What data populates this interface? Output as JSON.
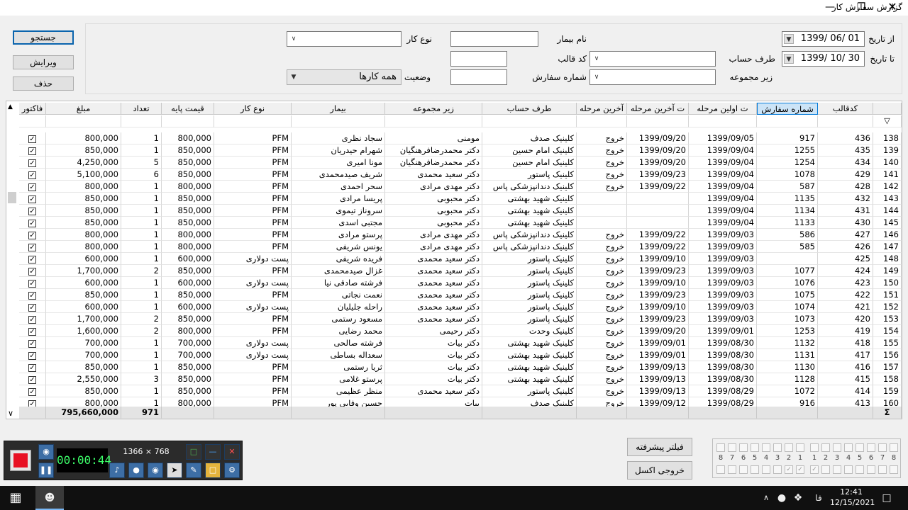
{
  "window": {
    "title": "گزارش سفارش کار"
  },
  "actions": {
    "search": "جستجو",
    "edit": "ویرایش",
    "delete": "حذف"
  },
  "filters": {
    "from_date_label": "از تاریخ",
    "from_date": "1399/ 06/ 01",
    "to_date_label": "تا تاریخ",
    "to_date": "1399/ 10/ 30",
    "account_party_label": "طرف حساب",
    "subgroup_label": "زیر مجموعه",
    "patient_name_label": "نام بیمار",
    "mold_code_label": "کد قالب",
    "order_number_label": "شماره سفارش",
    "work_type_label": "نوع کار",
    "status_label": "وضعیت",
    "status_value": "همه کارها"
  },
  "grid": {
    "columns": {
      "invoice": "فاکتور",
      "amount": "مبلغ",
      "count": "تعداد",
      "base_price": "قیمت پایه",
      "work_type": "نوع کار",
      "patient": "بیمار",
      "subgroup": "زیر مجموعه",
      "account_party": "طرف حساب",
      "last_stage": "آخرین مرحله",
      "last_stage_date": "ت آخرین مرحله",
      "first_stage_date": "ت اولین مرحله",
      "order_no": "شماره سفارش",
      "mold_code": "کدقالب"
    },
    "rows": [
      {
        "rn": "138",
        "mold": "436",
        "order": "917",
        "first": "1399/09/05",
        "lastd": "1399/09/20",
        "last": "خروج",
        "party": "کلینیک صدف",
        "sub": "مومنی",
        "patient": "سجاد نظری",
        "type": "PFM",
        "base": "800,000",
        "count": "1",
        "amount": "800,000"
      },
      {
        "rn": "139",
        "mold": "435",
        "order": "1255",
        "first": "1399/09/04",
        "lastd": "1399/09/20",
        "last": "خروج",
        "party": "کلینیک امام حسین",
        "sub": "دکتر محمدرضافرهنگیان",
        "patient": "شهرام حیدریان",
        "type": "PFM",
        "base": "850,000",
        "count": "1",
        "amount": "850,000"
      },
      {
        "rn": "140",
        "mold": "434",
        "order": "1254",
        "first": "1399/09/04",
        "lastd": "1399/09/20",
        "last": "خروج",
        "party": "کلینیک امام حسین",
        "sub": "دکتر محمدرضافرهنگیان",
        "patient": "مونا امیری",
        "type": "PFM",
        "base": "850,000",
        "count": "5",
        "amount": "4,250,000"
      },
      {
        "rn": "141",
        "mold": "429",
        "order": "1078",
        "first": "1399/09/04",
        "lastd": "1399/09/23",
        "last": "خروج",
        "party": "کلینیک پاستور",
        "sub": "دکتر سعید محمدی",
        "patient": "شریف صیدمحمدی",
        "type": "PFM",
        "base": "850,000",
        "count": "6",
        "amount": "5,100,000"
      },
      {
        "rn": "142",
        "mold": "428",
        "order": "587",
        "first": "1399/09/04",
        "lastd": "1399/09/22",
        "last": "خروج",
        "party": "کلینیک دندانپزشکی پاس",
        "sub": "دکتر مهدی مرادی",
        "patient": "سحر احمدی",
        "type": "PFM",
        "base": "800,000",
        "count": "1",
        "amount": "800,000"
      },
      {
        "rn": "143",
        "mold": "432",
        "order": "1135",
        "first": "1399/09/04",
        "lastd": "",
        "last": "",
        "party": "کلینیک شهید بهشتی",
        "sub": "دکتر محبوبی",
        "patient": "پریسا مرادی",
        "type": "PFM",
        "base": "850,000",
        "count": "1",
        "amount": "850,000"
      },
      {
        "rn": "144",
        "mold": "431",
        "order": "1134",
        "first": "1399/09/04",
        "lastd": "",
        "last": "",
        "party": "کلینیک شهید بهشتی",
        "sub": "دکتر محبوبی",
        "patient": "سروناز تیموی",
        "type": "PFM",
        "base": "850,000",
        "count": "1",
        "amount": "850,000"
      },
      {
        "rn": "145",
        "mold": "430",
        "order": "1133",
        "first": "1399/09/04",
        "lastd": "",
        "last": "",
        "party": "کلینیک شهید بهشتی",
        "sub": "دکتر محبوبی",
        "patient": "مجتبی اسدی",
        "type": "PFM",
        "base": "850,000",
        "count": "1",
        "amount": "850,000"
      },
      {
        "rn": "146",
        "mold": "427",
        "order": "586",
        "first": "1399/09/03",
        "lastd": "1399/09/22",
        "last": "خروج",
        "party": "کلینیک دندانپزشکی پاس",
        "sub": "دکتر مهدی مرادی",
        "patient": "پرستو مرادی",
        "type": "PFM",
        "base": "800,000",
        "count": "1",
        "amount": "800,000"
      },
      {
        "rn": "147",
        "mold": "426",
        "order": "585",
        "first": "1399/09/03",
        "lastd": "1399/09/22",
        "last": "خروج",
        "party": "کلینیک دندانپزشکی پاس",
        "sub": "دکتر مهدی مرادی",
        "patient": "یونس شریفی",
        "type": "PFM",
        "base": "800,000",
        "count": "1",
        "amount": "800,000"
      },
      {
        "rn": "148",
        "mold": "425",
        "order": "",
        "first": "1399/09/03",
        "lastd": "1399/09/10",
        "last": "خروج",
        "party": "کلینیک پاستور",
        "sub": "دکتر سعید محمدی",
        "patient": "فریده شریفی",
        "type": "پست دولاری",
        "base": "600,000",
        "count": "1",
        "amount": "600,000"
      },
      {
        "rn": "149",
        "mold": "424",
        "order": "1077",
        "first": "1399/09/03",
        "lastd": "1399/09/23",
        "last": "خروج",
        "party": "کلینیک پاستور",
        "sub": "دکتر سعید محمدی",
        "patient": "غزال صیدمحمدی",
        "type": "PFM",
        "base": "850,000",
        "count": "2",
        "amount": "1,700,000"
      },
      {
        "rn": "150",
        "mold": "423",
        "order": "1076",
        "first": "1399/09/03",
        "lastd": "1399/09/10",
        "last": "خروج",
        "party": "کلینیک پاستور",
        "sub": "دکتر سعید محمدی",
        "patient": "فرشته صادقی نیا",
        "type": "پست دولاری",
        "base": "600,000",
        "count": "1",
        "amount": "600,000"
      },
      {
        "rn": "151",
        "mold": "422",
        "order": "1075",
        "first": "1399/09/03",
        "lastd": "1399/09/23",
        "last": "خروج",
        "party": "کلینیک پاستور",
        "sub": "دکتر سعید محمدی",
        "patient": "نعمت نجاتی",
        "type": "PFM",
        "base": "850,000",
        "count": "1",
        "amount": "850,000"
      },
      {
        "rn": "152",
        "mold": "421",
        "order": "1074",
        "first": "1399/09/03",
        "lastd": "1399/09/10",
        "last": "خروج",
        "party": "کلینیک پاستور",
        "sub": "دکتر سعید محمدی",
        "patient": "راحله جلیلیان",
        "type": "پست دولاری",
        "base": "600,000",
        "count": "1",
        "amount": "600,000"
      },
      {
        "rn": "153",
        "mold": "420",
        "order": "1073",
        "first": "1399/09/03",
        "lastd": "1399/09/23",
        "last": "خروج",
        "party": "کلینیک پاستور",
        "sub": "دکتر سعید محمدی",
        "patient": "مسعود رستمی",
        "type": "PFM",
        "base": "850,000",
        "count": "2",
        "amount": "1,700,000"
      },
      {
        "rn": "154",
        "mold": "419",
        "order": "1253",
        "first": "1399/09/01",
        "lastd": "1399/09/20",
        "last": "خروج",
        "party": "کلینیک وحدت",
        "sub": "دکتر رحیمی",
        "patient": "محمد رضایی",
        "type": "PFM",
        "base": "800,000",
        "count": "2",
        "amount": "1,600,000"
      },
      {
        "rn": "155",
        "mold": "418",
        "order": "1132",
        "first": "1399/08/30",
        "lastd": "1399/09/01",
        "last": "خروج",
        "party": "کلینیک شهید بهشتی",
        "sub": "دکتر بیات",
        "patient": "فرشته صالحی",
        "type": "پست دولاری",
        "base": "700,000",
        "count": "1",
        "amount": "700,000"
      },
      {
        "rn": "156",
        "mold": "417",
        "order": "1131",
        "first": "1399/08/30",
        "lastd": "1399/09/01",
        "last": "خروج",
        "party": "کلینیک شهید بهشتی",
        "sub": "دکتر بیات",
        "patient": "سعداله بساطی",
        "type": "پست دولاری",
        "base": "700,000",
        "count": "1",
        "amount": "700,000"
      },
      {
        "rn": "157",
        "mold": "416",
        "order": "1130",
        "first": "1399/08/30",
        "lastd": "1399/09/13",
        "last": "خروج",
        "party": "کلینیک شهید بهشتی",
        "sub": "دکتر بیات",
        "patient": "ثریا رستمی",
        "type": "PFM",
        "base": "850,000",
        "count": "1",
        "amount": "850,000"
      },
      {
        "rn": "158",
        "mold": "415",
        "order": "1128",
        "first": "1399/08/30",
        "lastd": "1399/09/13",
        "last": "خروج",
        "party": "کلینیک شهید بهشتی",
        "sub": "دکتر بیات",
        "patient": "پرستو غلامی",
        "type": "PFM",
        "base": "850,000",
        "count": "3",
        "amount": "2,550,000"
      },
      {
        "rn": "159",
        "mold": "414",
        "order": "1072",
        "first": "1399/08/29",
        "lastd": "1399/09/13",
        "last": "خروج",
        "party": "کلینیک پاستور",
        "sub": "دکتر سعید محمدی",
        "patient": "منظر عظیمی",
        "type": "PFM",
        "base": "850,000",
        "count": "1",
        "amount": "850,000"
      },
      {
        "rn": "160",
        "mold": "413",
        "order": "916",
        "first": "1399/08/29",
        "lastd": "1399/09/12",
        "last": "خروج",
        "party": "کلینیک صدف",
        "sub": "بیات",
        "patient": "حسین وفایی پور",
        "type": "PFM",
        "base": "800,000",
        "count": "1",
        "amount": "800,000"
      }
    ],
    "totals": {
      "amount": "795,660,000",
      "count": "971",
      "sigma": "Σ"
    }
  },
  "bottom": {
    "advanced_filter": "فیلتر پیشرفته",
    "excel_export": "خروجی اکسل"
  },
  "recorder": {
    "timer": "00:00:44",
    "resolution": "1366 × 768"
  },
  "pager": {
    "top_labels": [
      "8",
      "7",
      "6",
      "5",
      "4",
      "3",
      "2",
      "1",
      "1",
      "2",
      "3",
      "4",
      "5",
      "6",
      "7",
      "8"
    ]
  },
  "taskbar": {
    "time": "12:41",
    "date": "12/15/2021",
    "lang": "فا"
  },
  "colors": {
    "accent": "#0078d7",
    "selected_header": "#cce4f7",
    "recorder_stop": "#e81123"
  }
}
